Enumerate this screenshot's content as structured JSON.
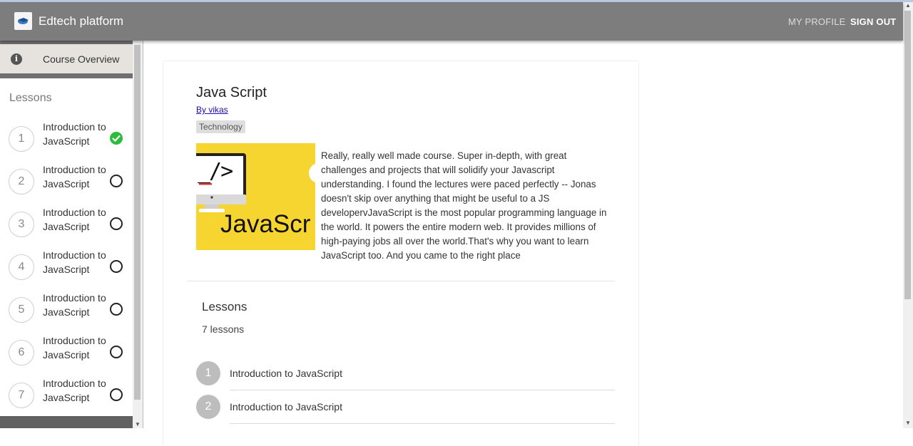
{
  "app": {
    "title": "Edtech platform",
    "nav_profile": "MY PROFILE",
    "nav_signout": "SIGN OUT"
  },
  "sidebar": {
    "overview_label": "Course Overview",
    "lessons_heading": "Lessons",
    "items": [
      {
        "number": "1",
        "label": "Introduction to JavaScript",
        "completed": true
      },
      {
        "number": "2",
        "label": "Introduction to JavaScript",
        "completed": false
      },
      {
        "number": "3",
        "label": "Introduction to JavaScript",
        "completed": false
      },
      {
        "number": "4",
        "label": "Introduction to JavaScript",
        "completed": false
      },
      {
        "number": "5",
        "label": "Introduction to JavaScript",
        "completed": false
      },
      {
        "number": "6",
        "label": "Introduction to JavaScript",
        "completed": false
      },
      {
        "number": "7",
        "label": "Introduction to JavaScript",
        "completed": false
      }
    ]
  },
  "course": {
    "title": "Java Script",
    "author": "By vikas",
    "category": "Technology",
    "image_text": "JavaScr",
    "image_code": "_/>",
    "description": "Really, really well made course. Super in-depth, with great challenges and projects that will solidify your Javascript understanding. I found the lectures were paced perfectly -- Jonas doesn't skip over anything that might be useful to a JS developervJavaScript is the most popular programming language in the world. It powers the entire modern web. It provides millions of high-paying jobs all over the world.That's why you want to learn JavaScript too. And you came to the right place"
  },
  "lessons_section": {
    "title": "Lessons",
    "count": "7 lessons",
    "items": [
      {
        "number": "1",
        "label": "Introduction to JavaScript"
      },
      {
        "number": "2",
        "label": "Introduction to JavaScript"
      }
    ]
  },
  "colors": {
    "appbar": "#7d7d7d",
    "check": "#2ebd3b",
    "image_bg": "#f7d531"
  }
}
